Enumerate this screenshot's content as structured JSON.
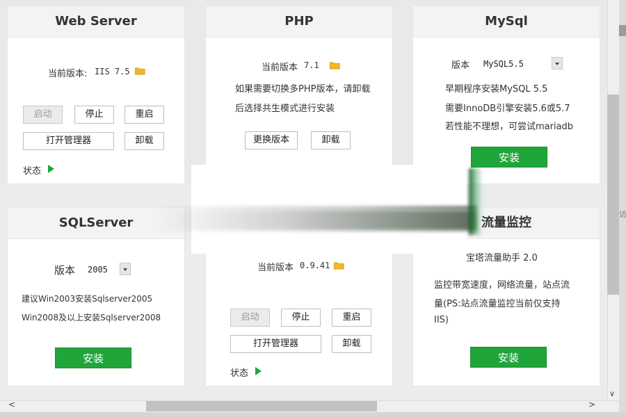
{
  "web_server": {
    "title": "Web Server",
    "version_label": "当前版本:",
    "version_value": "IIS 7.5",
    "start_label": "启动",
    "stop_label": "停止",
    "restart_label": "重启",
    "open_manager_label": "打开管理器",
    "uninstall_label": "卸载",
    "status_label": "状态"
  },
  "php": {
    "title": "PHP",
    "version_label": "当前版本",
    "version_value": "7.1",
    "note_line1": "如果需要切换多PHP版本，请卸载",
    "note_line2": "后选择共生模式进行安装",
    "change_version_label": "更换版本",
    "uninstall_label": "卸载"
  },
  "mysql": {
    "title": "MySql",
    "version_label": "版本",
    "version_selected": "MySQL5.5",
    "note_line1": "早期程序安装MySQL 5.5",
    "note_line2": "需要InnoDB引擎安装5.6或5.7",
    "note_line3": "若性能不理想，可尝试mariadb",
    "install_label": "安装"
  },
  "sqlserver": {
    "title": "SQLServer",
    "version_label": "版本",
    "version_selected": "2005",
    "note_line1": "建议Win2003安装Sqlserver2005",
    "note_line2": "Win2008及以上安装Sqlserver2008",
    "install_label": "安装"
  },
  "ftp": {
    "version_label": "当前版本",
    "version_value": "0.9.41",
    "start_label": "启动",
    "stop_label": "停止",
    "restart_label": "重启",
    "open_manager_label": "打开管理器",
    "uninstall_label": "卸载",
    "status_label": "状态"
  },
  "traffic": {
    "title": "流量监控",
    "subtitle": "宝塔流量助手 2.0",
    "note_line1": "监控带宽速度，网络流量，站点流",
    "note_line2": "量(PS:站点流量监控当前仅支持",
    "note_line3": "IIS)",
    "install_label": "安装"
  },
  "scrollbar": {
    "left_arrow": "<",
    "right_arrow": ">",
    "down_arrow": "∨"
  },
  "edge_char": "访",
  "colors": {
    "accent_green": "#20a53a",
    "folder_yellow": "#f5b820"
  }
}
